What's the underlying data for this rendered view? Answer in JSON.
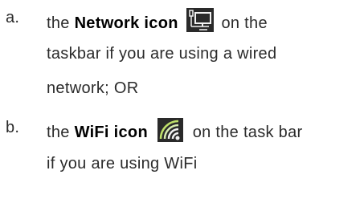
{
  "list": {
    "items": [
      {
        "marker": "a.",
        "lines": {
          "l1_pre": "the",
          "l1_bold": "Network icon",
          "l1_icon": "network-icon",
          "l1_post": "on the",
          "l2": "taskbar if you are using a wired",
          "l3": "network; OR"
        }
      },
      {
        "marker": "b.",
        "lines": {
          "l1_pre": "the",
          "l1_bold": "WiFi icon",
          "l1_icon": "wifi-icon",
          "l1_post": "on the task bar",
          "l2": "if you are using WiFi"
        }
      }
    ]
  },
  "colors": {
    "icon_bg": "#2a2a2a",
    "icon_fg": "#f2f2f2",
    "wifi_arc": "#bfe06a"
  }
}
